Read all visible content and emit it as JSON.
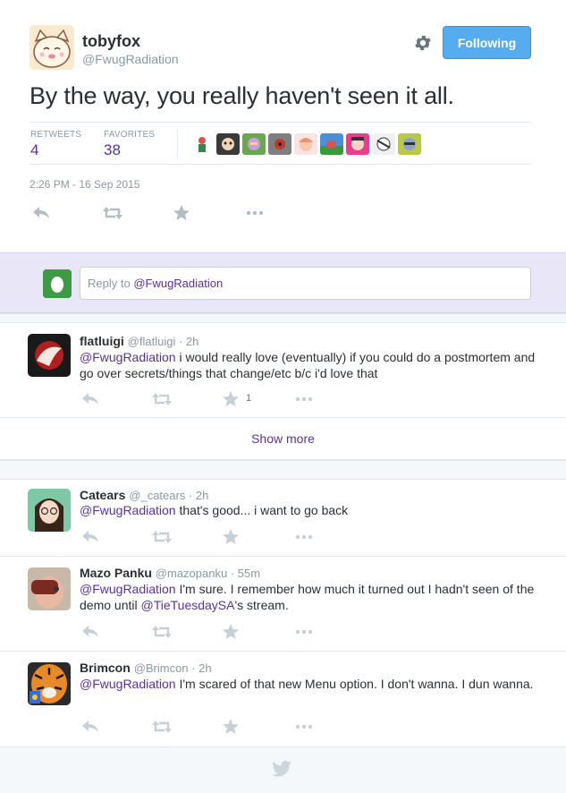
{
  "main_tweet": {
    "author_name": "tobyfox",
    "author_handle": "@FwugRadiation",
    "follow_label": "Following",
    "text": "By the way, you really haven't seen it all.",
    "retweets_label": "RETWEETS",
    "retweets_count": "4",
    "favorites_label": "FAVORITES",
    "favorites_count": "38",
    "timestamp": "2:26 PM - 16 Sep 2015"
  },
  "reply_box": {
    "prefix": "Reply to ",
    "mention": "@FwugRadiation"
  },
  "replies": [
    {
      "name": "flatluigi",
      "meta": "@flatluigi · 2h",
      "mention": "@FwugRadiation",
      "text": " i would really love (eventually) if you could do a postmortem and go over secrets/things that change/etc b/c i'd love that",
      "favorite_count": "1"
    },
    {
      "name": "Catears",
      "meta": "@_catears · 2h",
      "mention": "@FwugRadiation",
      "text": " that's good... i want to go back"
    },
    {
      "name": "Mazo Panku",
      "meta": "@mazopanku · 55m",
      "mention": "@FwugRadiation",
      "text": " I'm sure. I remember how much it turned out I hadn't seen of the demo until ",
      "mention2": "@TieTuesdaySA",
      "text2": "'s stream."
    },
    {
      "name": "Brimcon",
      "meta": "@Brimcon · 2h",
      "mention": "@FwugRadiation",
      "text": " I'm scared of that new Menu option. I don't wanna. I dun wanna."
    }
  ],
  "show_more_label": "Show more",
  "colors": {
    "accent": "#5c2fa0",
    "follow_button": "#55acee",
    "reply_band": "#e8e6f7",
    "muted": "#8899a6"
  }
}
